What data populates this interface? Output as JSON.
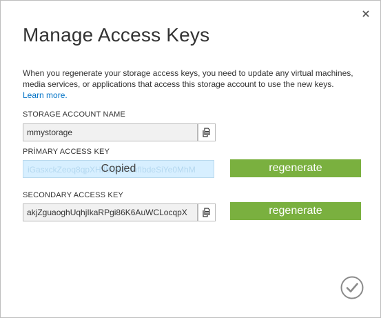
{
  "dialog": {
    "title": "Manage Access Keys",
    "description": "When you regenerate your storage access keys, you need to update any virtual machines, media services, or applications that access this storage account to use the new keys.",
    "learn_more": "Learn more."
  },
  "storage_account": {
    "label": "STORAGE ACCOUNT NAME",
    "value": "mmystorage"
  },
  "primary_key": {
    "label": "PRİMARY ACCESS KEY",
    "value": "iGasxckZeoq8qpXHfIbGBRanfIbdeSiYe0MhM",
    "overlay": "Copied",
    "regenerate_label": "regenerate"
  },
  "secondary_key": {
    "label": "SECONDARY ACCESS KEY",
    "value": "akjZguaoghUqhjIkaRPgi86K6AuWCLocqpX",
    "regenerate_label": "regenerate"
  },
  "colors": {
    "accent_green": "#7ab03f",
    "link_blue": "#0072c6",
    "copied_highlight": "#d7efff"
  },
  "icons": {
    "close": "close-icon",
    "copy": "copy-icon",
    "confirm": "checkmark-circle-icon"
  }
}
